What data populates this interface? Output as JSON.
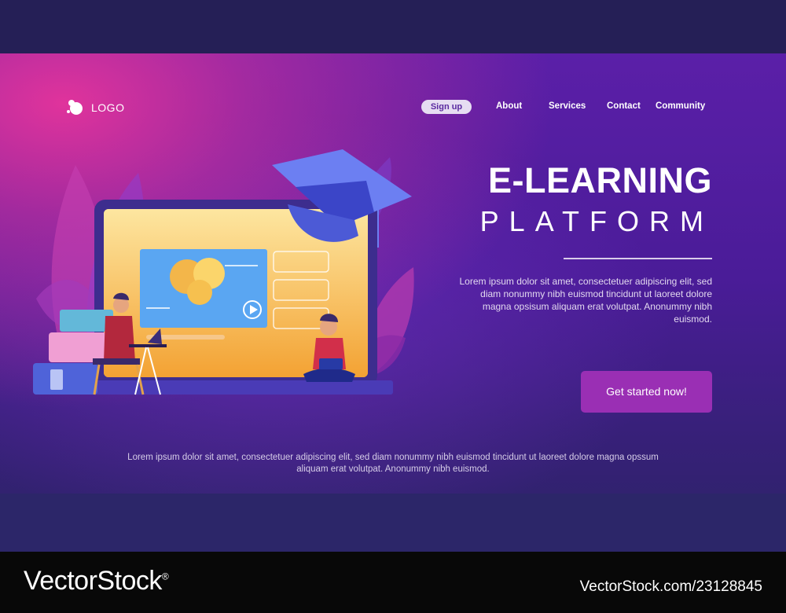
{
  "logo": {
    "text": "LOGO"
  },
  "nav": {
    "signup_label": "Sign up",
    "links": [
      {
        "label": "About"
      },
      {
        "label": "Services"
      },
      {
        "label": "Contact"
      },
      {
        "label": "Community"
      }
    ]
  },
  "hero": {
    "title_line1": "E-LEARNING",
    "title_line2": "PLATFORM",
    "description": "Lorem ipsum dolor sit amet, consectetuer adipiscing elit, sed diam nonummy nibh euismod tincidunt ut laoreet dolore magna opsisum aliquam erat volutpat. Anonummy nibh euismod.",
    "cta_label": "Get started now!"
  },
  "footer": {
    "text": "Lorem ipsum dolor sit amet, consectetuer adipiscing elit, sed diam nonummy nibh euismod tincidunt ut laoreet dolore magna opssum aliquam erat volutpat. Anonummy nibh euismod."
  },
  "watermark": {
    "brand": "VectorStock",
    "registered": "®",
    "id_text": "VectorStock.com/23128845"
  },
  "colors": {
    "background": "#251f56",
    "accent_pink": "#e0339c",
    "cta": "#9a2fb4",
    "signup_bg": "#e6ddf2"
  },
  "icons": [
    "logo-mark-icon",
    "play-icon",
    "graduation-cap-icon"
  ]
}
